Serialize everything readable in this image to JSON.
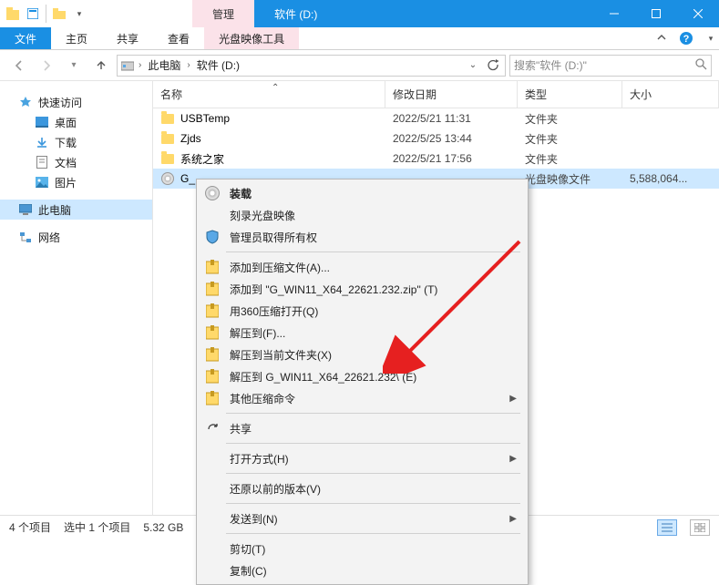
{
  "titlebar": {
    "manage_tab": "管理",
    "drive_tab": "软件 (D:)"
  },
  "ribbon": {
    "file": "文件",
    "home": "主页",
    "share": "共享",
    "view": "查看",
    "disc_tools": "光盘映像工具"
  },
  "address": {
    "root": "此电脑",
    "drive": "软件 (D:)",
    "search_placeholder": "搜索\"软件 (D:)\""
  },
  "sidebar": {
    "quick": "快速访问",
    "desktop": "桌面",
    "downloads": "下载",
    "documents": "文档",
    "pictures": "图片",
    "thispc": "此电脑",
    "network": "网络"
  },
  "columns": {
    "name": "名称",
    "date": "修改日期",
    "type": "类型",
    "size": "大小"
  },
  "rows": [
    {
      "name": "USBTemp",
      "date": "2022/5/21 11:31",
      "type": "文件夹",
      "size": ""
    },
    {
      "name": "Zjds",
      "date": "2022/5/25 13:44",
      "type": "文件夹",
      "size": ""
    },
    {
      "name": "系统之家",
      "date": "2022/5/21 17:56",
      "type": "文件夹",
      "size": ""
    },
    {
      "name": "G_",
      "date": "",
      "type": "光盘映像文件",
      "size": "5,588,064..."
    }
  ],
  "ctx": {
    "mount": "装载",
    "burn": "刻录光盘映像",
    "admin": "管理员取得所有权",
    "add_archive": "添加到压缩文件(A)...",
    "add_zip": "添加到 \"G_WIN11_X64_22621.232.zip\" (T)",
    "open_360": "用360压缩打开(Q)",
    "extract_to": "解压到(F)...",
    "extract_here": "解压到当前文件夹(X)",
    "extract_named": "解压到 G_WIN11_X64_22621.232\\ (E)",
    "other_zip": "其他压缩命令",
    "share": "共享",
    "open_with": "打开方式(H)",
    "restore": "还原以前的版本(V)",
    "send_to": "发送到(N)",
    "cut": "剪切(T)",
    "copy": "复制(C)"
  },
  "status": {
    "count": "4 个项目",
    "selection": "选中 1 个项目",
    "size": "5.32 GB"
  }
}
